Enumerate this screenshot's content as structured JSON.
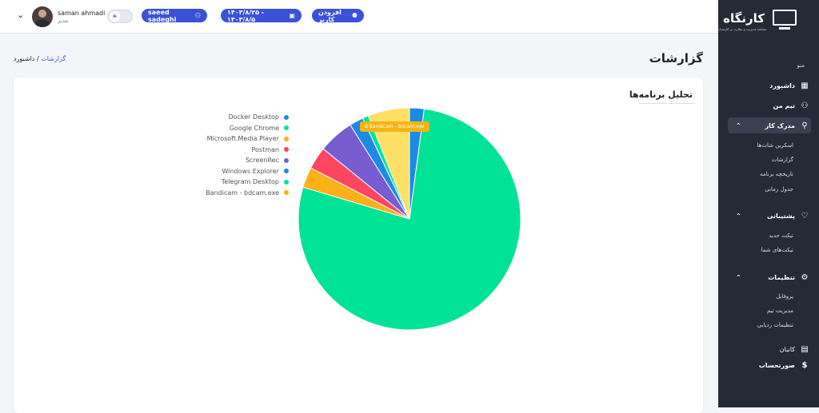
{
  "header": {
    "user_name": "saman ahmadi",
    "user_role": "مدیر",
    "user_pill": "saeed sadeghi",
    "date_range": "۱۴۰۳/۸/۲۵ - ۱۴۰۳/۸/۵",
    "add_user": "افزودن کاربر"
  },
  "page": {
    "title": "گزارشات",
    "breadcrumb_home": "داشبورد",
    "breadcrumb_sep": "/",
    "breadcrumb_current": "گزارشات"
  },
  "card": {
    "title": "تحلیل برنامه‌ها"
  },
  "tooltip": "8 Bandicam - bdcam.exe",
  "chart_data": {
    "type": "pie",
    "labels": [
      "Docker Desktop",
      "Google Chrome",
      "Microsoft.Media.Player",
      "Postman",
      "ScreenRec",
      "Windows Explorer",
      "Telegram Desktop",
      "Bandicam - bdcam.exe"
    ],
    "values": [
      2.2,
      80.6,
      3.1,
      3.4,
      5.4,
      2.1,
      0.9,
      6.3
    ],
    "colors": [
      "#1e88e5",
      "#00e396",
      "#feb019",
      "#ff4560",
      "#775dd0",
      "#1e88e5",
      "#00e396",
      "#ffe066"
    ],
    "legend_dot_colors": [
      "#1e88e5",
      "#00e396",
      "#feb019",
      "#ff4560",
      "#775dd0",
      "#1e88e5",
      "#00e396",
      "#feb019"
    ],
    "legend_position": "left"
  },
  "sidebar": {
    "logo_title": "کارنگاه",
    "logo_subtitle": "سامانه مدیریت و نظارت بر کارمندان",
    "menu_label": "منو",
    "dashboard": "داشبورد",
    "my_team": "تیم من",
    "work_evidence": "مدرک کار",
    "screenshots": "اسکرین شات‌ها",
    "reports": "گزارشات",
    "app_history": "تاریخچه برنامه",
    "schedule": "جدول زمانی",
    "support": "پشتیبانی",
    "new_ticket": "تیکت جدید",
    "your_tickets": "تیکت‌های شما",
    "settings": "تنظیمات",
    "profile": "پروفایل",
    "team_management": "مدیریت تیم",
    "tracking_settings": "تنظیمات ردیابی",
    "kanban": "کانبان",
    "billing": "صورتحساب"
  }
}
